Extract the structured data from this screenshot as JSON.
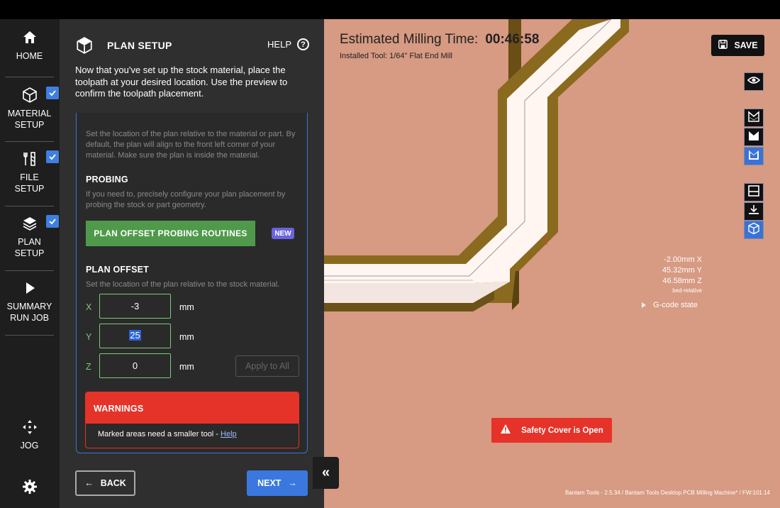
{
  "nav": {
    "home": "HOME",
    "material_l1": "MATERIAL",
    "material_l2": "SETUP",
    "file_l1": "FILE",
    "file_l2": "SETUP",
    "plan_l1": "PLAN",
    "plan_l2": "SETUP",
    "summary_l1": "SUMMARY",
    "summary_l2": "RUN JOB",
    "jog": "JOG"
  },
  "panel": {
    "title": "PLAN SETUP",
    "help": "HELP",
    "intro": "Now that you've set up the stock material, place the toolpath at your desired location. Use the preview to confirm the toolpath placement.",
    "location_desc": "Set the location of the plan relative to the material or part. By default, the plan will align to the front left corner of your material. Make sure the plan is inside the material.",
    "probing_title": "PROBING",
    "probing_desc": "If you need to, precisely configure your plan placement by probing the stock or part geometry.",
    "probing_button": "PLAN OFFSET PROBING ROUTINES",
    "new_badge": "NEW",
    "offset_title": "PLAN OFFSET",
    "offset_desc": "Set the location of the plan relative to the stock material.",
    "x_label": "X",
    "y_label": "Y",
    "z_label": "Z",
    "x_value": "-3",
    "y_value": "25",
    "z_value": "0",
    "unit": "mm",
    "apply_all": "Apply to All",
    "warnings_title": "WARNINGS",
    "warning_text": "Marked areas need a smaller tool - ",
    "warning_link": "Help",
    "back": "BACK",
    "next": "NEXT"
  },
  "preview": {
    "est_label": "Estimated Milling Time:",
    "est_time": "00:46:58",
    "tool": "Installed Tool: 1/64\" Flat End Mill",
    "save": "SAVE",
    "coord_x": "-2.00mm X",
    "coord_y": "45.32mm Y",
    "coord_z": "46.58mm Z",
    "coord_ref": "bed-relative",
    "gcode": "G-code state",
    "safety": "Safety Cover is Open",
    "footer": "Bantam Tools - 2.5.34 / Bantam Tools Desktop PCB Milling Machine* / FW:101.14"
  },
  "colors": {
    "accent": "#3a78e0",
    "probe_green": "#4f9a4a",
    "warning_red": "#e6332a",
    "stock": "#d79a82",
    "trace_gold": "#8a6a1e"
  }
}
